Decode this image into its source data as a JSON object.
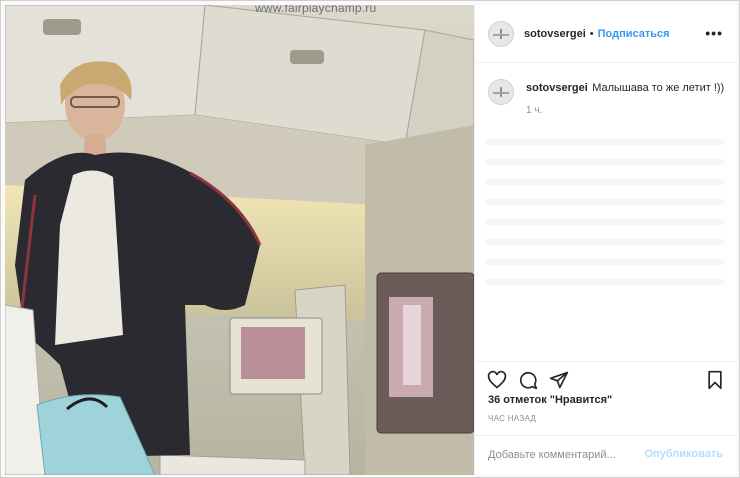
{
  "photo": {
    "watermark": "www.fairplaychamp.ru",
    "alt": "photo"
  },
  "post": {
    "username": "sotovsergei",
    "dot": "•",
    "follow_label": "Подписаться",
    "more_label": "•••"
  },
  "caption": {
    "username": "sotovsergei",
    "text": "Малышава то же летит !))",
    "time": "1 ч."
  },
  "actions": {
    "like_icon": "heart-icon",
    "comment_icon": "comment-icon",
    "share_icon": "share-icon",
    "save_icon": "bookmark-icon",
    "likes_text": "36 отметок \"Нравится\"",
    "posted_ago": "ЧАС НАЗАД"
  },
  "add_comment": {
    "placeholder": "Добавьте комментарий...",
    "publish_label": "Опубликовать"
  },
  "colors": {
    "accent": "#3897f0",
    "publish_disabled": "#b2dffc"
  }
}
